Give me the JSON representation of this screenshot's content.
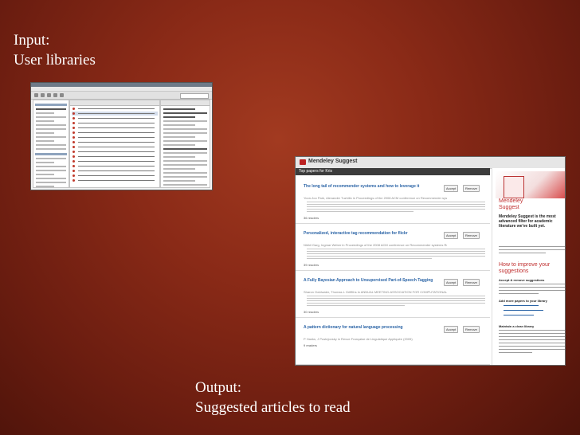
{
  "slide": {
    "input_heading": "Input:",
    "input_caption": "User libraries",
    "output_heading": "Output:",
    "output_caption": "Suggested articles to read"
  },
  "suggest_panel": {
    "app_title": "Mendeley Suggest",
    "section_label": "Top papers for Kris",
    "accept_label": "Accept",
    "remove_label": "Remove",
    "items": [
      {
        "title": "The long tail of recommender systems and how to leverage it",
        "meta": "Yoon-Joo Park, Alexander Tuzhilin in Proceedings of the 2008 ACM conference on Recommender systems RecSys 08 (2008)",
        "readers": "36 readers"
      },
      {
        "title": "Personalized, interactive tag recommendation for flickr",
        "meta": "Nikhil Garg, Ingmar Weber in Proceedings of the 2008 ACM conference on Recommender systems RecSys 08 (2008)",
        "readers": "39 readers"
      },
      {
        "title": "A Fully Bayesian Approach to Unsupervised Part-of-Speech Tagging",
        "meta": "Sharon Goldwater, Thomas L Griffiths in ANNUAL MEETING-ASSOCIATION FOR COMPUTATIONAL LINGUISTICS (2007)",
        "readers": "30 readers"
      },
      {
        "title": "A pattern dictionary for natural language processing",
        "meta": "P Hanks, J Pustejovsky in Revue Française de Linguistique Appliquée (2005)",
        "readers": "9 readers"
      }
    ],
    "side": {
      "promo_title_1": "Mendeley",
      "promo_title_2": "Suggest",
      "promo_sub": "Mendeley Suggest is the most advanced filter for academic literature we've built yet.",
      "how_to": "How to improve your suggestions",
      "accept_remove": "Accept & remove suggestions",
      "add_more": "Add more papers to your library",
      "maintain": "Maintain a clean library"
    }
  },
  "colors": {
    "link_blue": "#2b64a6",
    "mendeley_red": "#c03030",
    "slide_bg": "#8a2a17"
  }
}
